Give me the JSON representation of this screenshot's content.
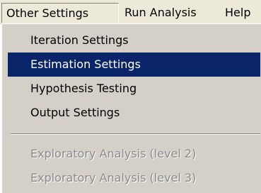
{
  "menubar": {
    "items": [
      {
        "label": "Other Settings",
        "open": true
      },
      {
        "label": "Run Analysis"
      },
      {
        "label": "Help"
      }
    ]
  },
  "dropdown": {
    "items": [
      {
        "label": "Iteration Settings",
        "state": "normal"
      },
      {
        "label": "Estimation Settings",
        "state": "selected"
      },
      {
        "label": "Hypothesis Testing",
        "state": "normal"
      },
      {
        "label": "Output Settings",
        "state": "normal"
      },
      {
        "label": "Exploratory Analysis (level 2)",
        "state": "disabled"
      },
      {
        "label": "Exploratory Analysis (level 3)",
        "state": "disabled"
      }
    ]
  },
  "colors": {
    "menu_background": "#d4d0c8",
    "selection_background": "#0a246a",
    "selection_text": "#ffffff",
    "disabled_text": "#8b8b8b"
  }
}
